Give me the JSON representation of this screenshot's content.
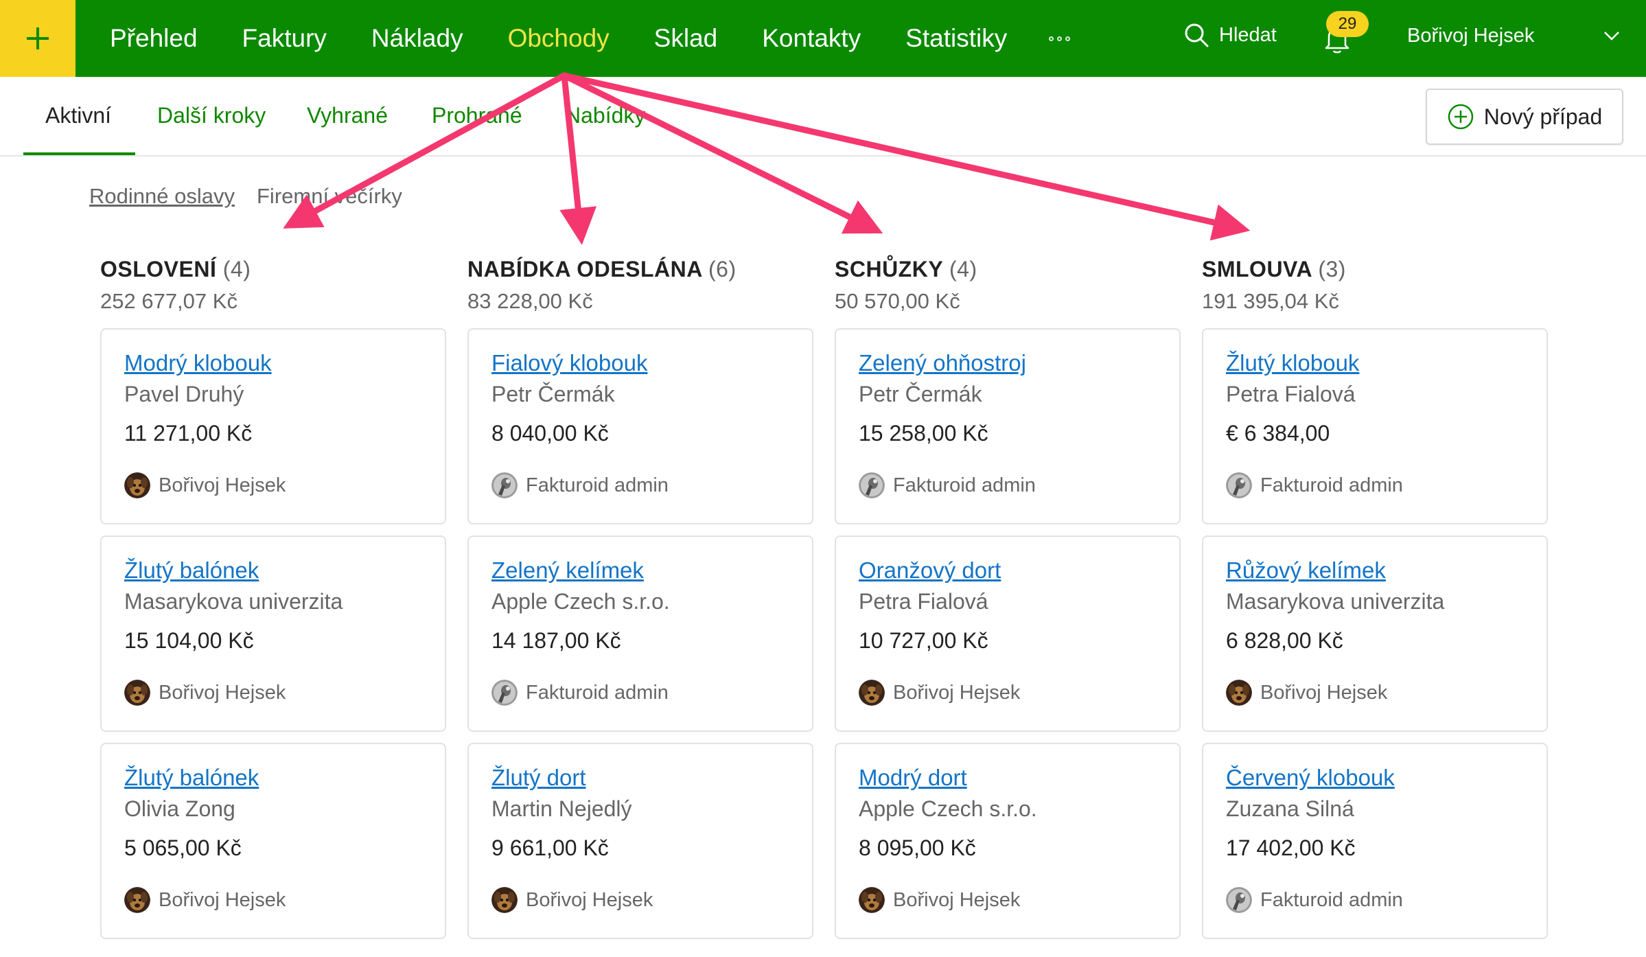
{
  "colors": {
    "topbar": "#0a8a00",
    "plus_button": "#f7d21e",
    "active_nav": "#f5e44a",
    "link": "#1374c7",
    "subtab": "#108700",
    "arrow": "#f4386f"
  },
  "topbar": {
    "plus_icon": "plus-icon",
    "nav": [
      {
        "label": "Přehled"
      },
      {
        "label": "Faktury"
      },
      {
        "label": "Náklady"
      },
      {
        "label": "Obchody",
        "active": true
      },
      {
        "label": "Sklad"
      },
      {
        "label": "Kontakty"
      },
      {
        "label": "Statistiky"
      }
    ],
    "more_icon": "more-dots-icon",
    "search_label": "Hledat",
    "notifications_count": "29",
    "user_name": "Bořivoj Hejsek"
  },
  "subtabs": [
    {
      "label": "Aktivní",
      "active": true
    },
    {
      "label": "Další kroky"
    },
    {
      "label": "Vyhrané"
    },
    {
      "label": "Prohrané"
    },
    {
      "label": "Nabídky"
    }
  ],
  "new_case_label": "Nový případ",
  "pipelines": [
    {
      "label": "Rodinné oslavy",
      "active": true
    },
    {
      "label": "Firemní večírky"
    }
  ],
  "columns": [
    {
      "title": "OSLOVENÍ",
      "count": "(4)",
      "total": "252 677,07 Kč",
      "cards": [
        {
          "title": "Modrý klobouk",
          "client": "Pavel Druhý",
          "amount": "11 271,00 Kč",
          "owner": "Bořivoj Hejsek",
          "avatar": "dog"
        },
        {
          "title": "Žlutý balónek",
          "client": "Masarykova univerzita",
          "amount": "15 104,00 Kč",
          "owner": "Bořivoj Hejsek",
          "avatar": "dog"
        },
        {
          "title": "Žlutý balónek",
          "client": "Olivia Zong",
          "amount": "5 065,00 Kč",
          "owner": "Bořivoj Hejsek",
          "avatar": "dog"
        }
      ]
    },
    {
      "title": "NABÍDKA ODESLÁNA",
      "count": "(6)",
      "total": "83 228,00 Kč",
      "cards": [
        {
          "title": "Fialový klobouk",
          "client": "Petr Čermák",
          "amount": "8 040,00 Kč",
          "owner": "Fakturoid admin",
          "avatar": "admin"
        },
        {
          "title": "Zelený kelímek",
          "client": "Apple Czech s.r.o.",
          "amount": "14 187,00 Kč",
          "owner": "Fakturoid admin",
          "avatar": "admin"
        },
        {
          "title": "Žlutý dort",
          "client": "Martin Nejedlý",
          "amount": "9 661,00 Kč",
          "owner": "Bořivoj Hejsek",
          "avatar": "dog"
        }
      ]
    },
    {
      "title": "SCHŮZKY",
      "count": "(4)",
      "total": "50 570,00 Kč",
      "cards": [
        {
          "title": "Zelený ohňostroj",
          "client": "Petr Čermák",
          "amount": "15 258,00 Kč",
          "owner": "Fakturoid admin",
          "avatar": "admin"
        },
        {
          "title": "Oranžový dort",
          "client": "Petra Fialová",
          "amount": "10 727,00 Kč",
          "owner": "Bořivoj Hejsek",
          "avatar": "dog"
        },
        {
          "title": "Modrý dort",
          "client": "Apple Czech s.r.o.",
          "amount": "8 095,00 Kč",
          "owner": "Bořivoj Hejsek",
          "avatar": "dog"
        }
      ]
    },
    {
      "title": "SMLOUVA",
      "count": "(3)",
      "total": "191 395,04 Kč",
      "cards": [
        {
          "title": "Žlutý klobouk",
          "client": "Petra Fialová",
          "amount": "€ 6 384,00",
          "owner": "Fakturoid admin",
          "avatar": "admin"
        },
        {
          "title": "Růžový kelímek",
          "client": "Masarykova univerzita",
          "amount": "6 828,00 Kč",
          "owner": "Bořivoj Hejsek",
          "avatar": "dog"
        },
        {
          "title": "Červený klobouk",
          "client": "Zuzana Silná",
          "amount": "17 402,00 Kč",
          "owner": "Fakturoid admin",
          "avatar": "admin"
        }
      ]
    }
  ]
}
